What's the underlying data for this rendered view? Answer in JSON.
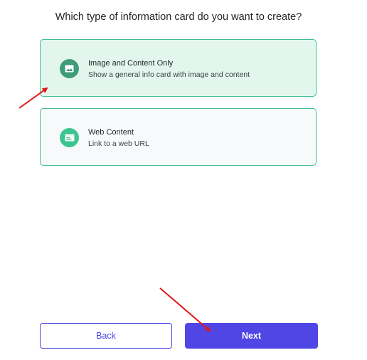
{
  "question": "Which type of information card do you want to create?",
  "options": [
    {
      "title": "Image and Content Only",
      "description": "Show a general info card with image and content",
      "icon": "image-icon",
      "selected": true
    },
    {
      "title": "Web Content",
      "description": "Link to a web URL",
      "icon": "web-browser-icon",
      "selected": false
    }
  ],
  "buttons": {
    "back": "Back",
    "next": "Next"
  },
  "colors": {
    "selected_bg": "#e2f6ee",
    "option_border": "#3fbf8f",
    "primary": "#4f46e5",
    "annotation_arrow": "#e3161b"
  }
}
